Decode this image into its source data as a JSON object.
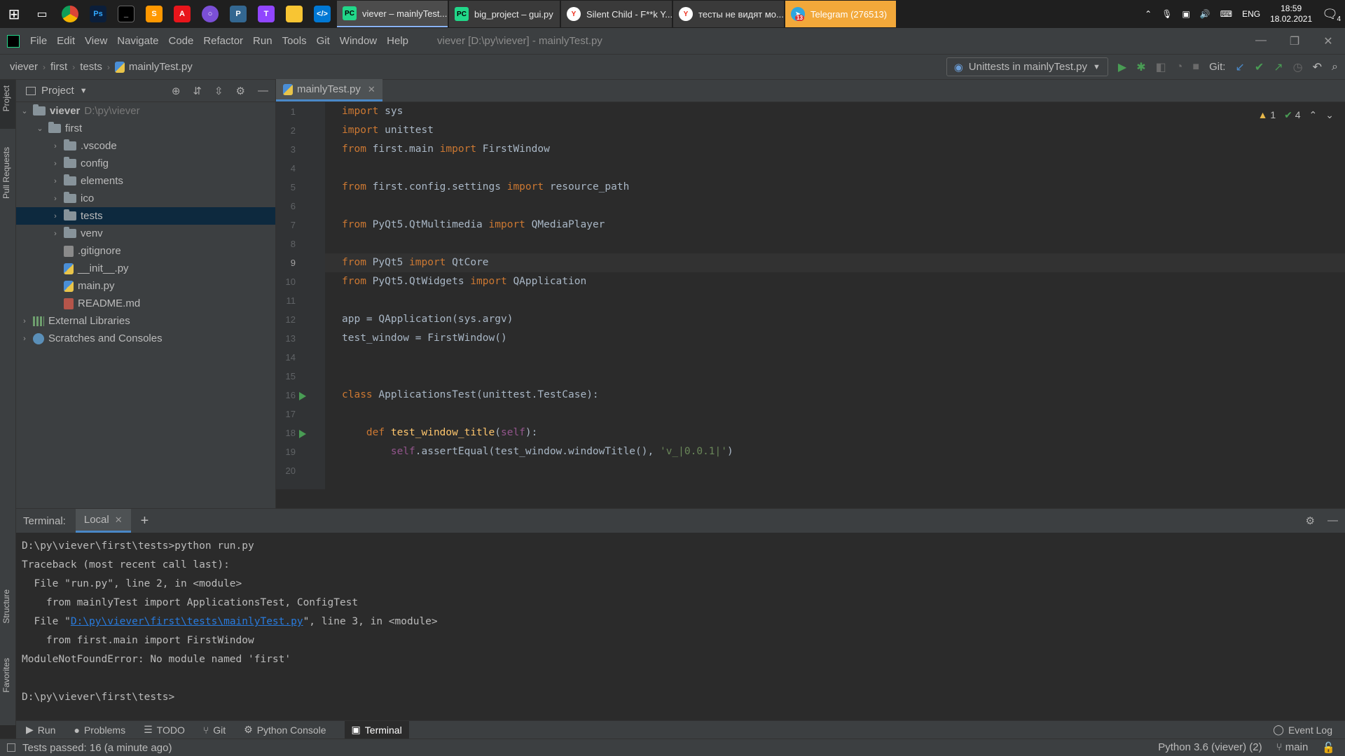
{
  "taskbar": {
    "tasks": [
      {
        "label": "viever – mainlyTest....",
        "active": true
      },
      {
        "label": "big_project – gui.py",
        "active": false
      },
      {
        "label": "Silent Child - F**k Y...",
        "active": false
      },
      {
        "label": "тесты не видят мо...",
        "active": false
      },
      {
        "label": "Telegram (276513)",
        "active": false
      }
    ],
    "telegram_badge": "13",
    "lang": "ENG",
    "time": "18:59",
    "date": "18.02.2021",
    "notifications": "4"
  },
  "menu": {
    "items": [
      "File",
      "Edit",
      "View",
      "Navigate",
      "Code",
      "Refactor",
      "Run",
      "Tools",
      "Git",
      "Window",
      "Help"
    ],
    "window_title": "viever [D:\\py\\viever] - mainlyTest.py"
  },
  "nav": {
    "breadcrumbs": [
      "viever",
      "first",
      "tests",
      "mainlyTest.py"
    ],
    "run_config": "Unittests in mainlyTest.py",
    "git_label": "Git:"
  },
  "stripe": {
    "project": "Project",
    "pull_requests": "Pull Requests",
    "structure": "Structure",
    "favorites": "Favorites"
  },
  "project": {
    "title": "Project",
    "root_name": "viever",
    "root_path": "D:\\py\\viever",
    "first": "first",
    "folders": [
      ".vscode",
      "config",
      "elements",
      "ico",
      "tests",
      "venv"
    ],
    "gitignore": ".gitignore",
    "init": "__init__.py",
    "main": "main.py",
    "readme": "README.md",
    "external": "External Libraries",
    "scratches": "Scratches and Consoles"
  },
  "editor": {
    "tab": "mainlyTest.py",
    "warnings": "1",
    "passed": "4",
    "line_numbers": [
      "1",
      "2",
      "3",
      "4",
      "5",
      "6",
      "7",
      "8",
      "9",
      "10",
      "11",
      "12",
      "13",
      "14",
      "15",
      "16",
      "17",
      "18",
      "19",
      "20"
    ],
    "l1a": "import",
    "l1b": " sys",
    "l2a": "import",
    "l2b": " unittest",
    "l3a": "from",
    "l3b": " first.main ",
    "l3c": "import",
    "l3d": " FirstWindow",
    "l5a": "from",
    "l5b": " first.config.settings ",
    "l5c": "import",
    "l5d": " resource_path",
    "l7a": "from",
    "l7b": " PyQt5.QtMultimedia ",
    "l7c": "import",
    "l7d": " QMediaPlayer",
    "l9a": "from",
    "l9b": " PyQt5 ",
    "l9c": "import",
    "l9d": " QtCore",
    "l10a": "from",
    "l10b": " PyQt5.QtWidgets ",
    "l10c": "import",
    "l10d": " QApplication",
    "l12": "app = QApplication(sys.argv)",
    "l13": "test_window = FirstWindow()",
    "l16a": "class",
    "l16b": " ApplicationsTest(unittest.TestCase):",
    "l18a": "    def",
    "l18b": " test_window_title",
    "l18c": "(",
    "l18d": "self",
    "l18e": "):",
    "l19a": "        ",
    "l19b": "self",
    "l19c": ".assertEqual(test_window.windowTitle(), ",
    "l19d": "'v_|0.0.1|'",
    "l19e": ")"
  },
  "terminal": {
    "label": "Terminal:",
    "tab": "Local",
    "lines": [
      "D:\\py\\viever\\first\\tests>python run.py",
      "Traceback (most recent call last):",
      "  File \"run.py\", line 2, in <module>",
      "    from mainlyTest import ApplicationsTest, ConfigTest"
    ],
    "line5_pre": "  File \"",
    "line5_link": "D:\\py\\viever\\first\\tests\\mainlyTest.py",
    "line5_post": "\", line 3, in <module>",
    "line6": "    from first.main import FirstWindow",
    "line7": "ModuleNotFoundError: No module named 'first'",
    "prompt": "D:\\py\\viever\\first\\tests>"
  },
  "toolwindows": {
    "run": "Run",
    "problems": "Problems",
    "todo": "TODO",
    "git": "Git",
    "console": "Python Console",
    "terminal": "Terminal",
    "eventlog": "Event Log"
  },
  "status": {
    "message": "Tests passed: 16 (a minute ago)",
    "interpreter": "Python 3.6 (viever) (2)",
    "branch": "main"
  },
  "colors": {
    "keyword": "#cc7832",
    "function": "#ffc66d",
    "string": "#6a8759",
    "selection": "#0d293e",
    "accent": "#4a88c7"
  }
}
